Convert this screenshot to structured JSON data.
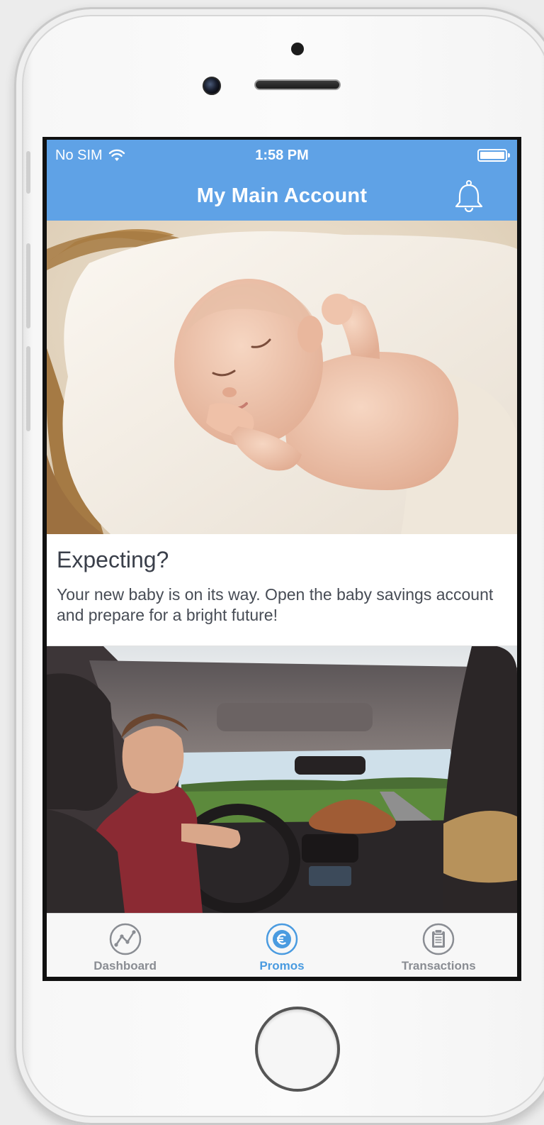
{
  "status_bar": {
    "carrier": "No SIM",
    "time": "1:58 PM"
  },
  "nav": {
    "title": "My Main Account",
    "bell_icon": "bell-icon"
  },
  "promos": [
    {
      "image": "sleeping-baby-in-basket",
      "title": "Expecting?",
      "body": "Your new baby is on its way. Open the baby savings account and prepare for a bright future!"
    },
    {
      "image": "road-trip-car-interior"
    }
  ],
  "tabs": [
    {
      "label": "Dashboard",
      "icon": "chart-line-icon",
      "active": false
    },
    {
      "label": "Promos",
      "icon": "euro-icon",
      "active": true
    },
    {
      "label": "Transactions",
      "icon": "clipboard-icon",
      "active": false
    }
  ],
  "colors": {
    "accent": "#5fa2e6",
    "tab_active": "#4a9be0",
    "tab_inactive": "#8a8d93"
  }
}
